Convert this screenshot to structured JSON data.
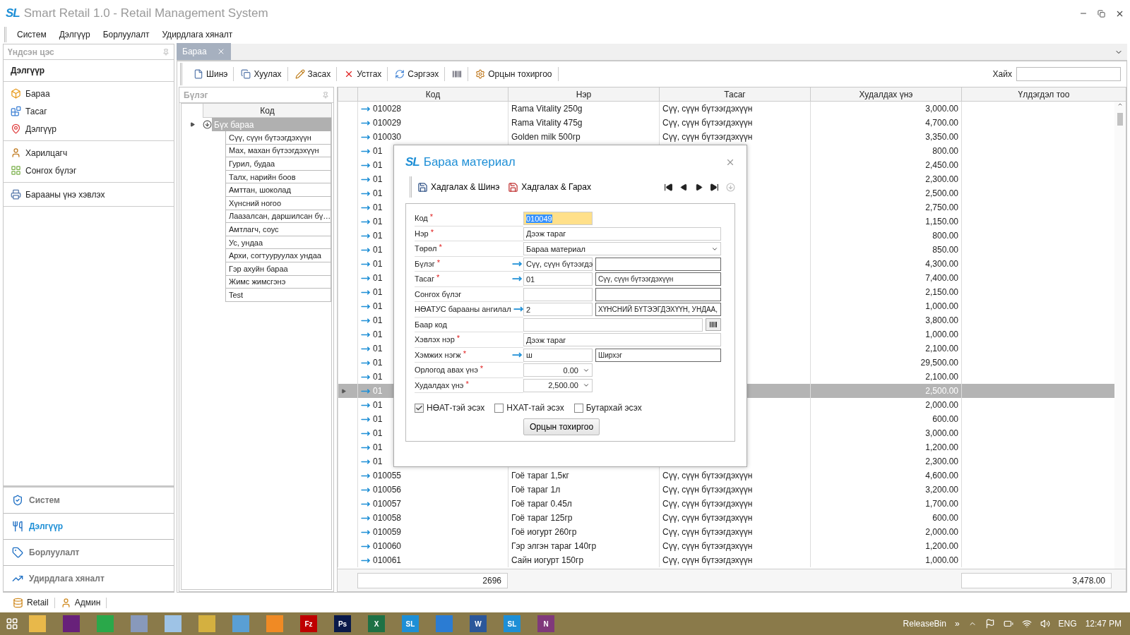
{
  "window": {
    "logo": "SL",
    "title": "Smart Retail 1.0 - Retail Management System"
  },
  "menu": [
    "Систем",
    "Дэлгүүр",
    "Борлуулалт",
    "Удирдлага хяналт"
  ],
  "sidebar": {
    "header": "Үндсэн цэс",
    "section": "Дэлгүүр",
    "groups": [
      [
        "Бараа",
        "Тасаг",
        "Дэлгүүр"
      ],
      [
        "Харилцагч",
        "Сонгох бүлэг"
      ],
      [
        "Барааны үнэ хэвлэх"
      ]
    ],
    "nav": [
      {
        "label": "Систем",
        "selected": false
      },
      {
        "label": "Дэлгүүр",
        "selected": true
      },
      {
        "label": "Борлуулалт",
        "selected": false
      },
      {
        "label": "Удирдлага хяналт",
        "selected": false
      }
    ]
  },
  "tabs": [
    {
      "label": "Бараа",
      "selected": true
    }
  ],
  "toolbar": {
    "buttons": [
      {
        "kind": "button",
        "label": "Шинэ"
      },
      {
        "kind": "button",
        "label": "Хуулах"
      },
      {
        "kind": "button",
        "label": "Засах"
      },
      {
        "kind": "button",
        "label": "Устгах"
      },
      {
        "kind": "button",
        "label": "Сэргээх"
      },
      {
        "kind": "icon"
      },
      {
        "kind": "button",
        "label": "Орцын тохиргоо"
      }
    ],
    "search_label": "Хайх"
  },
  "tree": {
    "header": "Бүлэг",
    "column": "Код",
    "root": {
      "label": "Бүх бараа",
      "selected": true,
      "expanded": true,
      "children": [
        {
          "label": "Сүү, сүүн бүтээгдэхүүн"
        },
        {
          "label": "Мах, махан бүтээгдэхүүн"
        },
        {
          "label": "Гурил, будаа"
        },
        {
          "label": "Талх, нарийн боов"
        },
        {
          "label": "Амттан, шоколад"
        },
        {
          "label": "Хүнсний ногоо"
        },
        {
          "label": "Лаазалсан, даршилсан бү…"
        },
        {
          "label": "Амтлагч, соус"
        },
        {
          "label": "Ус, ундаа"
        },
        {
          "label": "Архи, согтууруулах ундаа"
        },
        {
          "label": "Гэр ахуйн бараа"
        },
        {
          "label": "Жимс жимсгэнэ"
        },
        {
          "label": "Test"
        }
      ]
    }
  },
  "table": {
    "columns": [
      "Код",
      "Нэр",
      "Тасаг",
      "Худалдах үнэ",
      "Үлдэгдэл тоо"
    ],
    "rows": [
      {
        "code": "010028",
        "name": "Rama Vitality 250g",
        "dept": "Сүү, сүүн бүтээгдэхүүн",
        "price": "3,000.00",
        "selected": false
      },
      {
        "code": "010029",
        "name": "Rama Vitality 475g",
        "dept": "Сүү, сүүн бүтээгдэхүүн",
        "price": "4,700.00",
        "selected": false
      },
      {
        "code": "010030",
        "name": "Golden milk 500гр",
        "dept": "Сүү, сүүн бүтээгдэхүүн",
        "price": "3,350.00",
        "selected": false
      },
      {
        "code": "01",
        "price": "800.00",
        "selected": false
      },
      {
        "code": "01",
        "price": "2,450.00",
        "selected": false
      },
      {
        "code": "01",
        "price": "2,300.00",
        "selected": false
      },
      {
        "code": "01",
        "price": "2,500.00",
        "selected": false
      },
      {
        "code": "01",
        "price": "2,750.00",
        "selected": false
      },
      {
        "code": "01",
        "price": "1,150.00",
        "selected": false
      },
      {
        "code": "01",
        "price": "800.00",
        "selected": false
      },
      {
        "code": "01",
        "price": "850.00",
        "selected": false
      },
      {
        "code": "01",
        "price": "4,300.00",
        "selected": false
      },
      {
        "code": "01",
        "price": "7,400.00",
        "selected": false
      },
      {
        "code": "01",
        "price": "2,150.00",
        "selected": false
      },
      {
        "code": "01",
        "price": "1,000.00",
        "selected": false
      },
      {
        "code": "01",
        "price": "3,800.00",
        "selected": false
      },
      {
        "code": "01",
        "price": "1,000.00",
        "selected": false
      },
      {
        "code": "01",
        "price": "2,100.00",
        "selected": false
      },
      {
        "code": "01",
        "price": "29,500.00",
        "selected": false
      },
      {
        "code": "01",
        "price": "2,100.00",
        "selected": false
      },
      {
        "code": "01",
        "price": "2,500.00",
        "selected": true
      },
      {
        "code": "01",
        "price": "2,000.00",
        "selected": false
      },
      {
        "code": "01",
        "price": "600.00",
        "selected": false
      },
      {
        "code": "01",
        "price": "3,000.00",
        "selected": false
      },
      {
        "code": "01",
        "price": "1,200.00",
        "selected": false
      },
      {
        "code": "01",
        "price": "2,300.00",
        "selected": false
      },
      {
        "code": "010055",
        "name": "Гоё тараг 1,5кг",
        "dept": "Сүү, сүүн бүтээгдэхүүн",
        "price": "4,600.00",
        "selected": false
      },
      {
        "code": "010056",
        "name": "Гоё тараг 1л",
        "dept": "Сүү, сүүн бүтээгдэхүүн",
        "price": "3,200.00",
        "selected": false
      },
      {
        "code": "010057",
        "name": "Гоё тараг 0.45л",
        "dept": "Сүү, сүүн бүтээгдэхүүн",
        "price": "1,700.00",
        "selected": false
      },
      {
        "code": "010058",
        "name": "Гоё тараг 125гр",
        "dept": "Сүү, сүүн бүтээгдэхүүн",
        "price": "600.00",
        "selected": false
      },
      {
        "code": "010059",
        "name": "Гоё иогурт 260гр",
        "dept": "Сүү, сүүн бүтээгдэхүүн",
        "price": "2,000.00",
        "selected": false
      },
      {
        "code": "010060",
        "name": "Гэр элгэн тараг 140гр",
        "dept": "Сүү, сүүн бүтээгдэхүүн",
        "price": "1,200.00",
        "selected": false
      },
      {
        "code": "010061",
        "name": "Сайн иогурт 150гр",
        "dept": "Сүү, сүүн бүтээгдэхүүн",
        "price": "1,000.00",
        "selected": false
      }
    ],
    "footer": {
      "count": "2696",
      "total": "3,478.00"
    }
  },
  "dialog": {
    "logo": "SL",
    "title": "Бараа материал",
    "actions": [
      "Хадгалах & Шинэ",
      "Хадгалах & Гарах"
    ],
    "fields": [
      {
        "label": "Код",
        "mark": "*",
        "kind": "code",
        "value": "010049"
      },
      {
        "label": "Нэр",
        "mark": "*",
        "kind": "text",
        "value": "Дээж тараг"
      },
      {
        "label": "Төрөл",
        "mark": "*",
        "kind": "combo",
        "value": "Бараа материал"
      },
      {
        "label": "Бүлэг",
        "mark": "*",
        "kind": "pair",
        "lookup": true,
        "value": "Сүү, сүүн бүтээгдэ"
      },
      {
        "label": "Тасаг",
        "mark": "*",
        "kind": "pair",
        "lookup": true,
        "value": "01",
        "value2": "Сүү, сүүн бүтээгдэхүүн"
      },
      {
        "label": "Сонгох бүлэг",
        "kind": "pair",
        "lookup": false
      },
      {
        "label": "НӨАТУС барааны ангилал",
        "kind": "pair",
        "lookup": true,
        "value": "2",
        "value2": "ХҮНСНИЙ БҮТЭЭГДЭХҮҮН, УНДАА,"
      },
      {
        "label": "Баар код",
        "kind": "barcode"
      },
      {
        "label": "Хэвлэх нэр",
        "mark": "*",
        "kind": "text",
        "value": "Дээж тараг"
      },
      {
        "label": "Хэмжих нэгж",
        "mark": "*",
        "kind": "pair",
        "lookup": true,
        "value": "ш",
        "value2": "Ширхэг"
      },
      {
        "label": "Орлогод авах үнэ",
        "mark": "*",
        "kind": "spin",
        "value": "0.00"
      },
      {
        "label": "Худалдах үнэ",
        "mark": "*",
        "kind": "spin",
        "value": "2,500.00"
      }
    ],
    "checks": [
      {
        "label": "НӨАТ-тэй эсэх",
        "checked": true
      },
      {
        "label": "НХАТ-тай эсэх",
        "checked": false
      },
      {
        "label": "Бутархай эсэх",
        "checked": false
      }
    ],
    "button": "Орцын тохиргоо"
  },
  "status_bar": [
    "Retail",
    "Админ"
  ],
  "taskbar": {
    "apps": [
      {
        "color": "#e8b84a"
      },
      {
        "color": "#68217a"
      },
      {
        "color": "#2aa84a"
      },
      {
        "color": "#8899bb"
      },
      {
        "color": "#9ec3e6"
      },
      {
        "color": "#d4b040"
      },
      {
        "color": "#5a9fd4"
      },
      {
        "color": "#f08a24"
      },
      {
        "color": "#bf0000",
        "glyph": "Fz"
      },
      {
        "color": "#0a1a4a",
        "glyph": "Ps"
      },
      {
        "color": "#1e7145",
        "glyph": "X"
      },
      {
        "color": "#1e8fd6",
        "glyph": "SL"
      },
      {
        "color": "#2b7cd3"
      },
      {
        "color": "#2b579a",
        "glyph": "W"
      },
      {
        "color": "#1e8fd6",
        "glyph": "SL"
      },
      {
        "color": "#80397b",
        "glyph": "N"
      }
    ],
    "tray_label": "ReleaseBin",
    "tray_more": "»",
    "lang": "ENG",
    "time": "12:47 PM"
  }
}
